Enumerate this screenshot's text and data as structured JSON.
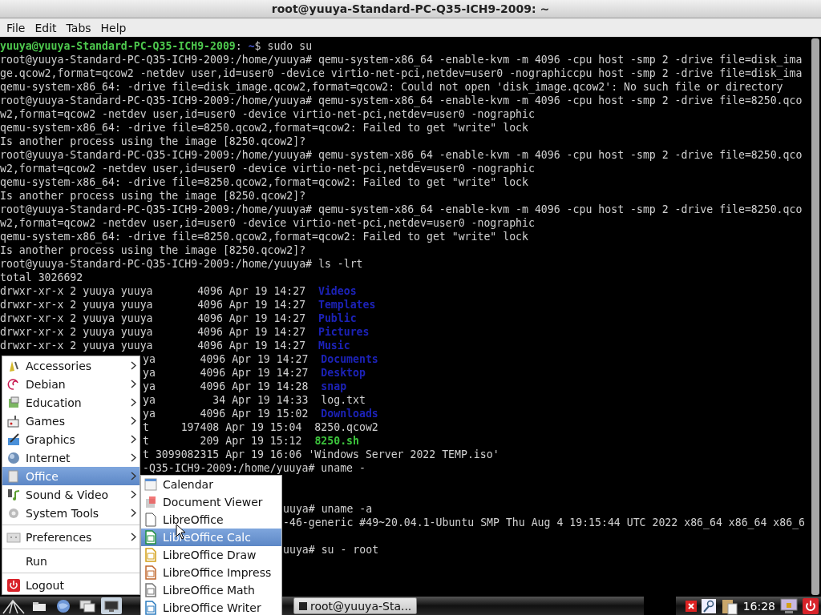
{
  "window": {
    "title": "root@yuuya-Standard-PC-Q35-ICH9-2009: ~"
  },
  "menubar": [
    "File",
    "Edit",
    "Tabs",
    "Help"
  ],
  "terminal": {
    "lines": [
      {
        "segments": [
          {
            "text": "yuuya@yuuya-Standard-PC-Q35-ICH9-2009",
            "kind": "user"
          },
          {
            "text": ":",
            "kind": "plain"
          },
          {
            "text": " ~",
            "kind": "path"
          },
          {
            "text": "$ sudo su",
            "kind": "plain"
          }
        ]
      },
      {
        "text": "root@yuuya-Standard-PC-Q35-ICH9-2009:/home/yuuya# qemu-system-x86_64 -enable-kvm -m 4096 -cpu host -smp 2 -drive file=disk_ima"
      },
      {
        "text": "ge.qcow2,format=qcow2 -netdev user,id=user0 -device virtio-net-pci,netdev=user0 -nographiccpu host -smp 2 -drive file=disk_ima"
      },
      {
        "text": "qemu-system-x86_64: -drive file=disk_image.qcow2,format=qcow2: Could not open 'disk_image.qcow2': No such file or directory"
      },
      {
        "text": "root@yuuya-Standard-PC-Q35-ICH9-2009:/home/yuuya# qemu-system-x86_64 -enable-kvm -m 4096 -cpu host -smp 2 -drive file=8250.qco"
      },
      {
        "text": "w2,format=qcow2 -netdev user,id=user0 -device virtio-net-pci,netdev=user0 -nographic"
      },
      {
        "text": "qemu-system-x86_64: -drive file=8250.qcow2,format=qcow2: Failed to get \"write\" lock"
      },
      {
        "text": "Is another process using the image [8250.qcow2]?"
      },
      {
        "text": "root@yuuya-Standard-PC-Q35-ICH9-2009:/home/yuuya# qemu-system-x86_64 -enable-kvm -m 4096 -cpu host -smp 2 -drive file=8250.qco"
      },
      {
        "text": "w2,format=qcow2 -netdev user,id=user0 -device virtio-net-pci,netdev=user0 -nographic"
      },
      {
        "text": "qemu-system-x86_64: -drive file=8250.qcow2,format=qcow2: Failed to get \"write\" lock"
      },
      {
        "text": "Is another process using the image [8250.qcow2]?"
      },
      {
        "text": "root@yuuya-Standard-PC-Q35-ICH9-2009:/home/yuuya# qemu-system-x86_64 -enable-kvm -m 4096 -cpu host -smp 2 -drive file=8250.qco"
      },
      {
        "text": "w2,format=qcow2 -netdev user,id=user0 -device virtio-net-pci,netdev=user0 -nographic"
      },
      {
        "text": "qemu-system-x86_64: -drive file=8250.qcow2,format=qcow2: Failed to get \"write\" lock"
      },
      {
        "text": "Is another process using the image [8250.qcow2]?"
      },
      {
        "text": "root@yuuya-Standard-PC-Q35-ICH9-2009:/home/yuuya# ls -lrt"
      },
      {
        "text": "total 3026692"
      },
      {
        "segments": [
          {
            "text": "drwxr-xr-x 2 yuuya yuuya       4096 Apr 19 14:27  ",
            "kind": "plain"
          },
          {
            "text": "Videos",
            "kind": "dir"
          }
        ]
      },
      {
        "segments": [
          {
            "text": "drwxr-xr-x 2 yuuya yuuya       4096 Apr 19 14:27  ",
            "kind": "plain"
          },
          {
            "text": "Templates",
            "kind": "dir"
          }
        ]
      },
      {
        "segments": [
          {
            "text": "drwxr-xr-x 2 yuuya yuuya       4096 Apr 19 14:27  ",
            "kind": "plain"
          },
          {
            "text": "Public",
            "kind": "dir"
          }
        ]
      },
      {
        "segments": [
          {
            "text": "drwxr-xr-x 2 yuuya yuuya       4096 Apr 19 14:27  ",
            "kind": "plain"
          },
          {
            "text": "Pictures",
            "kind": "dir"
          }
        ]
      },
      {
        "segments": [
          {
            "text": "drwxr-xr-x 2 yuuya yuuya       4096 Apr 19 14:27  ",
            "kind": "plain"
          },
          {
            "text": "Music",
            "kind": "dir"
          }
        ]
      }
    ],
    "lines_beside_menu": [
      {
        "segments": [
          {
            "text": "ya       4096 Apr 19 14:27  ",
            "kind": "plain"
          },
          {
            "text": "Documents",
            "kind": "dir"
          }
        ]
      },
      {
        "segments": [
          {
            "text": "ya       4096 Apr 19 14:27  ",
            "kind": "plain"
          },
          {
            "text": "Desktop",
            "kind": "dir"
          }
        ]
      },
      {
        "segments": [
          {
            "text": "ya       4096 Apr 19 14:28  ",
            "kind": "plain"
          },
          {
            "text": "snap",
            "kind": "dir"
          }
        ]
      },
      {
        "text": "ya         34 Apr 19 14:33  log.txt"
      },
      {
        "segments": [
          {
            "text": "ya       4096 Apr 19 15:02  ",
            "kind": "plain"
          },
          {
            "text": "Downloads",
            "kind": "dir"
          }
        ]
      },
      {
        "text": "t     197408 Apr 19 15:04  8250.qcow2"
      },
      {
        "segments": [
          {
            "text": "t        209 Apr 19 15:12  ",
            "kind": "plain"
          },
          {
            "text": "8250.sh",
            "kind": "exec"
          }
        ]
      },
      {
        "text": "t 3099082315 Apr 19 16:06 'Windows Server 2022 TEMP.iso'"
      },
      {
        "text": "-Q35-ICH9-2009:/home/yuuya# uname -"
      }
    ],
    "lines_beside_submenu": [
      {
        "kind": "blank"
      },
      {
        "kind": "blank"
      },
      {
        "text": "uuya# uname -a"
      },
      {
        "text": "-46-generic #49~20.04.1-Ubuntu SMP Thu Aug 4 19:15:44 UTC 2022 x86_64 x86_64 x86_6"
      },
      {
        "kind": "blank"
      },
      {
        "text": "uuya# su - root"
      }
    ]
  },
  "app_menu": {
    "items": [
      {
        "kind": "item",
        "label": "Accessories",
        "submenu": true,
        "selected": false
      },
      {
        "kind": "item",
        "label": "Debian",
        "submenu": true,
        "selected": false
      },
      {
        "kind": "item",
        "label": "Education",
        "submenu": true,
        "selected": false
      },
      {
        "kind": "item",
        "label": "Games",
        "submenu": true,
        "selected": false
      },
      {
        "kind": "item",
        "label": "Graphics",
        "submenu": true,
        "selected": false
      },
      {
        "kind": "item",
        "label": "Internet",
        "submenu": true,
        "selected": false
      },
      {
        "kind": "item",
        "label": "Office",
        "submenu": true,
        "selected": true
      },
      {
        "kind": "item",
        "label": "Sound & Video",
        "submenu": true,
        "selected": false
      },
      {
        "kind": "item",
        "label": "System Tools",
        "submenu": true,
        "selected": false
      },
      {
        "kind": "separator"
      },
      {
        "kind": "item",
        "label": "Preferences",
        "submenu": true,
        "selected": false
      },
      {
        "kind": "separator"
      },
      {
        "kind": "item",
        "label": "Run",
        "submenu": false,
        "selected": false
      },
      {
        "kind": "separator"
      },
      {
        "kind": "item",
        "label": "Logout",
        "submenu": false,
        "selected": false
      }
    ]
  },
  "office_submenu": {
    "items": [
      {
        "label": "Calendar",
        "selected": false
      },
      {
        "label": "Document Viewer",
        "selected": false
      },
      {
        "label": "LibreOffice",
        "selected": false
      },
      {
        "label": "LibreOffice Calc",
        "selected": true
      },
      {
        "label": "LibreOffice Draw",
        "selected": false
      },
      {
        "label": "LibreOffice Impress",
        "selected": false
      },
      {
        "label": "LibreOffice Math",
        "selected": false
      },
      {
        "label": "LibreOffice Writer",
        "selected": false
      }
    ]
  },
  "taskbar": {
    "launchers": [
      {
        "selected": false
      },
      {
        "selected": false
      },
      {
        "selected": false
      },
      {
        "selected": true
      }
    ],
    "tasks": [
      {
        "label": "root@yuuya-Sta...",
        "selected": false
      }
    ],
    "clock": "16:28"
  }
}
